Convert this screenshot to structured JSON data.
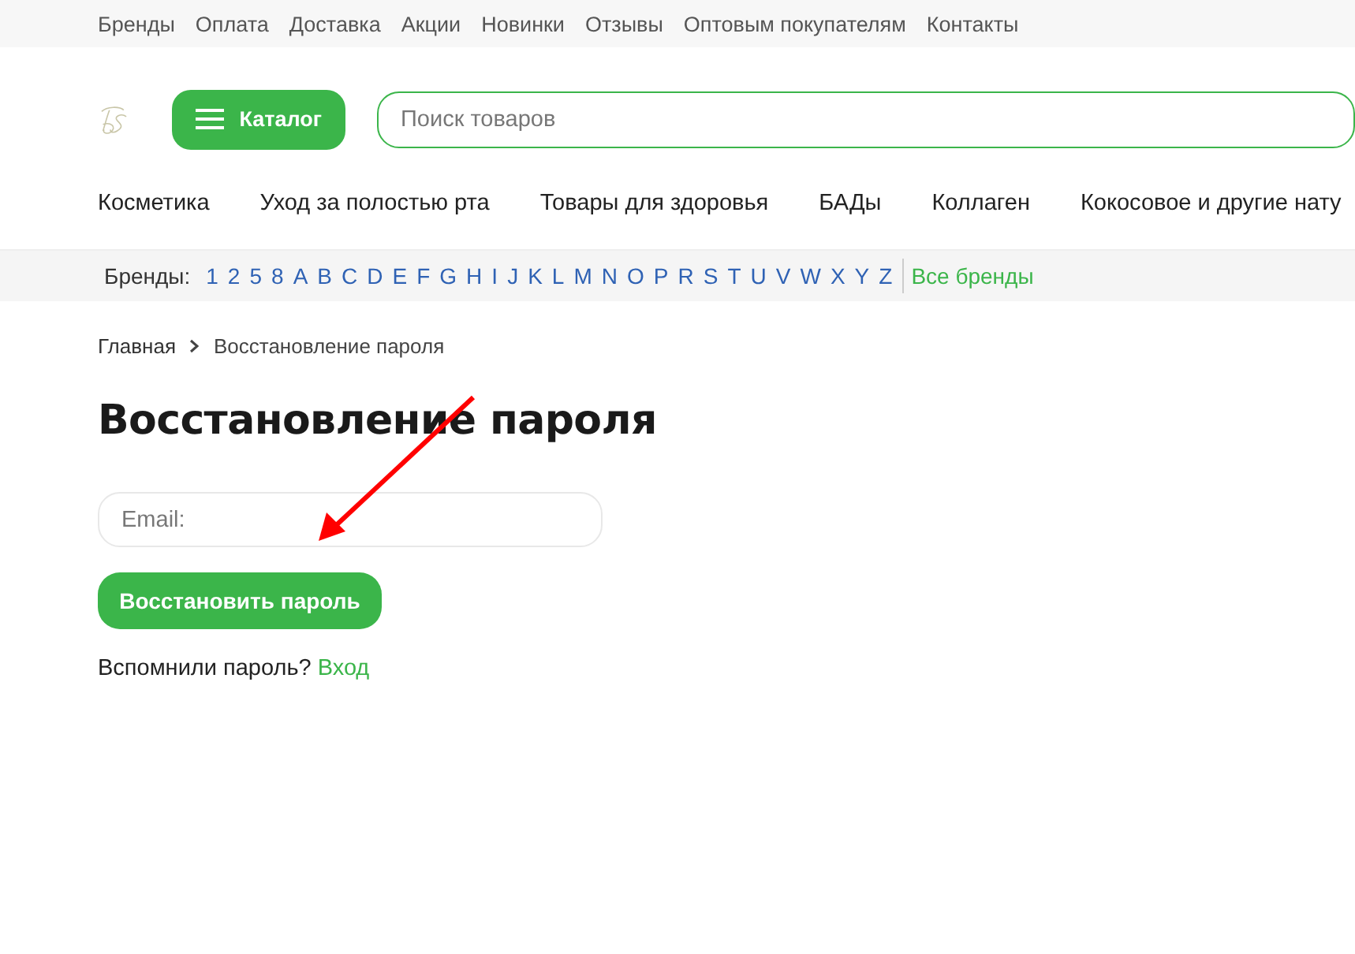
{
  "top_menu": [
    "Бренды",
    "Оплата",
    "Доставка",
    "Акции",
    "Новинки",
    "Отзывы",
    "Оптовым покупателям",
    "Контакты"
  ],
  "header": {
    "catalog_button": "Каталог",
    "search": {
      "placeholder": "Поиск товаров"
    }
  },
  "categories": [
    "Косметика",
    "Уход за полостью рта",
    "Товары для здоровья",
    "БАДы",
    "Коллаген",
    "Кокосовое и другие нату"
  ],
  "brands_bar": {
    "label": "Бренды:",
    "letters": [
      "1",
      "2",
      "5",
      "8",
      "A",
      "B",
      "C",
      "D",
      "E",
      "F",
      "G",
      "H",
      "I",
      "J",
      "K",
      "L",
      "M",
      "N",
      "O",
      "P",
      "R",
      "S",
      "T",
      "U",
      "V",
      "W",
      "X",
      "Y",
      "Z"
    ],
    "all_link": "Все бренды"
  },
  "breadcrumb": [
    "Главная",
    "Восстановление пароля"
  ],
  "title": "Восстановление пароля",
  "form": {
    "email": {
      "placeholder": "Email:"
    },
    "submit": "Восстановить пароль",
    "remember_text": "Вспомнили пароль?",
    "login_link": "Вход"
  }
}
